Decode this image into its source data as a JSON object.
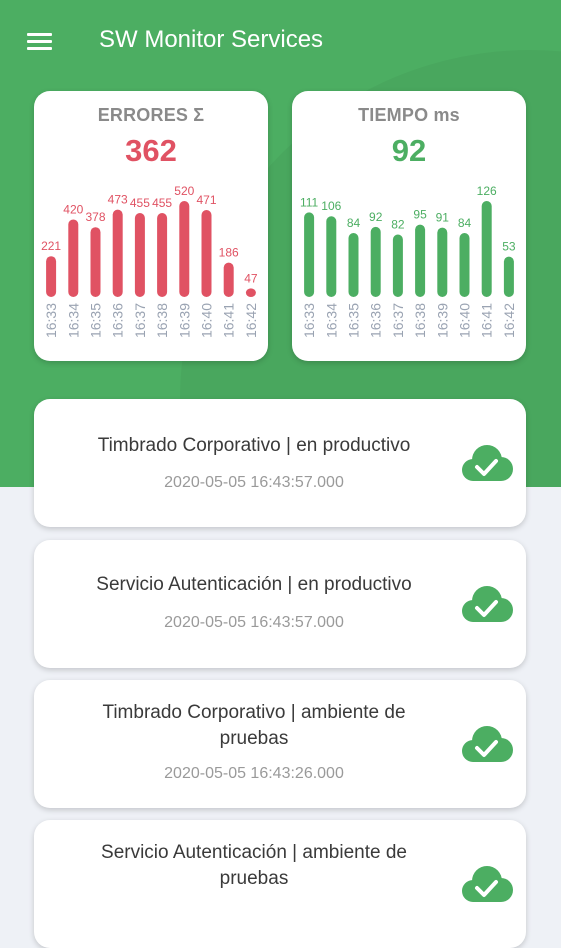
{
  "app": {
    "title": "SW Monitor Services",
    "accent_color": "#4cae62",
    "menu_icon": "hamburger-menu-icon"
  },
  "summary": {
    "errors": {
      "title": "ERRORES Σ",
      "value": "362",
      "color": "#e05263"
    },
    "time": {
      "title": "TIEMPO ms",
      "value": "92",
      "color": "#4cae62"
    }
  },
  "chart_data": [
    {
      "type": "bar",
      "title": "ERRORES Σ",
      "categories": [
        "16:33",
        "16:34",
        "16:35",
        "16:36",
        "16:37",
        "16:38",
        "16:39",
        "16:40",
        "16:41",
        "16:42"
      ],
      "values": [
        221,
        420,
        378,
        473,
        455,
        455,
        520,
        471,
        186,
        47
      ],
      "color": "#e05263",
      "ylim": [
        0,
        520
      ],
      "grid": false
    },
    {
      "type": "bar",
      "title": "TIEMPO ms",
      "categories": [
        "16:33",
        "16:34",
        "16:35",
        "16:36",
        "16:37",
        "16:38",
        "16:39",
        "16:40",
        "16:41",
        "16:42"
      ],
      "values": [
        111,
        106,
        84,
        92,
        82,
        95,
        91,
        84,
        126,
        53
      ],
      "color": "#4cae62",
      "ylim": [
        0,
        126
      ],
      "grid": false
    }
  ],
  "services": [
    {
      "name": "Timbrado Corporativo | en productivo",
      "timestamp": "2020-05-05 16:43:57.000",
      "status_icon": "cloud-check-icon"
    },
    {
      "name": "Servicio Autenticación | en productivo",
      "timestamp": "2020-05-05 16:43:57.000",
      "status_icon": "cloud-check-icon"
    },
    {
      "name": "Timbrado Corporativo | ambiente de pruebas",
      "timestamp": "2020-05-05 16:43:26.000",
      "status_icon": "cloud-check-icon"
    },
    {
      "name": "Servicio Autenticación | ambiente de pruebas",
      "timestamp": "",
      "status_icon": "cloud-check-icon"
    }
  ]
}
